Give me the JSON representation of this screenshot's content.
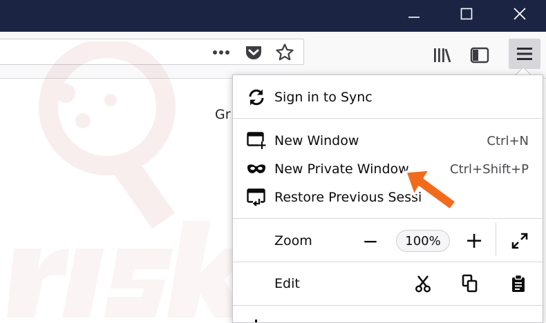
{
  "window": {
    "minimize_icon": "minimize-icon",
    "maximize_icon": "maximize-icon",
    "close_icon": "close-icon"
  },
  "toolbar": {
    "page_actions_icon": "more-actions-icon",
    "pocket_icon": "pocket-icon",
    "bookmark_icon": "star-icon",
    "library_icon": "library-icon",
    "sidebar_icon": "sidebar-icon",
    "menu_icon": "hamburger-menu-icon"
  },
  "content": {
    "text": "Gr"
  },
  "menu": {
    "sync": {
      "label": "Sign in to Sync",
      "icon": "sync-icon"
    },
    "new_window": {
      "label": "New Window",
      "shortcut": "Ctrl+N",
      "icon": "new-window-icon"
    },
    "new_private_window": {
      "label": "New Private Window",
      "shortcut": "Ctrl+Shift+P",
      "icon": "private-mask-icon"
    },
    "restore_session": {
      "label": "Restore Previous Sessi",
      "icon": "restore-session-icon"
    },
    "zoom": {
      "label": "Zoom",
      "value": "100%",
      "minus": "−",
      "plus": "+",
      "fullscreen_icon": "fullscreen-icon"
    },
    "edit": {
      "label": "Edit",
      "cut_icon": "scissors-icon",
      "copy_icon": "copy-icon",
      "paste_icon": "clipboard-icon"
    }
  },
  "colors": {
    "titlebar": "#1b2543",
    "toolbar": "#f9f9fa",
    "menu_button_active": "#d7d7db",
    "arrow_orange": "#f26b1d"
  }
}
